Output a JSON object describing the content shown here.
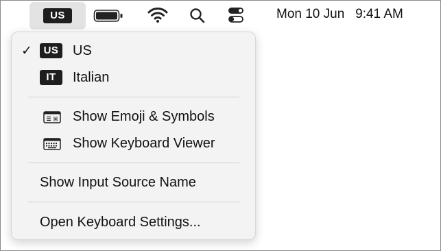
{
  "menubar": {
    "input_source_badge": "US",
    "datetime": "Mon 10 Jun   9:41 AM",
    "icons": [
      "battery-icon",
      "wifi-icon",
      "search-icon",
      "control-center-icon"
    ]
  },
  "menu": {
    "sources": [
      {
        "badge": "US",
        "label": "US",
        "checked": "✓"
      },
      {
        "badge": "IT",
        "label": "Italian",
        "checked": ""
      }
    ],
    "actions": [
      {
        "icon": "emoji-symbols-icon",
        "label": "Show Emoji & Symbols"
      },
      {
        "icon": "keyboard-viewer-icon",
        "label": "Show Keyboard Viewer"
      }
    ],
    "show_input_source_name": "Show Input Source Name",
    "open_keyboard_settings": "Open Keyboard Settings..."
  }
}
